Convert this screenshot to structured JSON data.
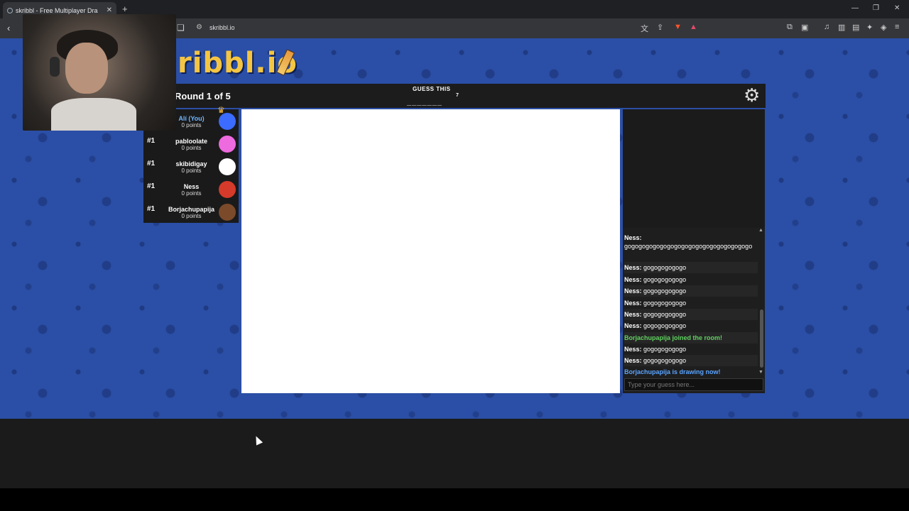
{
  "browser": {
    "tab_title": "skribbl - Free Multiplayer Dra",
    "url": "skribbl.io"
  },
  "logo": {
    "text": "ribbl.io"
  },
  "game": {
    "round": "Round 1 of 5",
    "guess_label": "GUESS THIS",
    "word_length": "7",
    "word_blanks": "_______"
  },
  "players": [
    {
      "rank": "",
      "name": "Alí (You)",
      "points": "0 points",
      "avatar_color": "#3b6bff",
      "is_you": true
    },
    {
      "rank": "#1",
      "name": "pabloolate",
      "points": "0 points",
      "avatar_color": "#ee6adf"
    },
    {
      "rank": "#1",
      "name": "skibidigay",
      "points": "0 points",
      "avatar_color": "#ffffff"
    },
    {
      "rank": "#1",
      "name": "Ness",
      "points": "0 points",
      "avatar_color": "#d63a2a"
    },
    {
      "rank": "#1",
      "name": "Borjachupapija",
      "points": "0 points",
      "avatar_color": "#7a4a2a"
    }
  ],
  "chat": {
    "messages": [
      {
        "author": "Ness:",
        "text": "gogogogogogogogogogogogogogogogogogo"
      },
      {
        "author": "Ness:",
        "text": "gogogogogogo"
      },
      {
        "author": "Ness:",
        "text": "gogogogogogo"
      },
      {
        "author": "Ness:",
        "text": "gogogogogogo"
      },
      {
        "author": "Ness:",
        "text": "gogogogogogo"
      },
      {
        "author": "Ness:",
        "text": "gogogogogogo"
      },
      {
        "author": "Ness:",
        "text": "gogogogogogo"
      },
      {
        "system": "Borjachupapija joined the room!",
        "kind": "join"
      },
      {
        "author": "Ness:",
        "text": "gogogogogogo"
      },
      {
        "author": "Ness:",
        "text": "gogogogogogo"
      },
      {
        "system": "Borjachupapija is drawing now!",
        "kind": "drawing"
      }
    ],
    "input_placeholder": "Type your guess here..."
  },
  "colors": {
    "background_blue": "#2b4fa6",
    "join_green": "#5fd15f",
    "drawing_blue": "#5aa4ff"
  }
}
